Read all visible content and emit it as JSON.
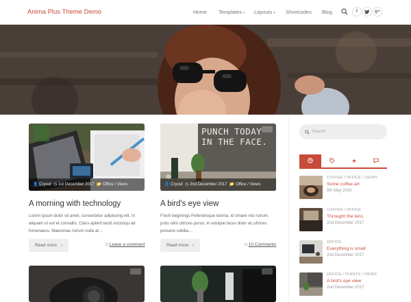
{
  "site": {
    "title": "Anima Plus Theme Demo"
  },
  "nav": [
    {
      "label": "Home",
      "dropdown": false
    },
    {
      "label": "Templates",
      "dropdown": true
    },
    {
      "label": "Layouts",
      "dropdown": true
    },
    {
      "label": "Shortcodes",
      "dropdown": false
    },
    {
      "label": "Blog",
      "dropdown": false
    }
  ],
  "social": {
    "facebook": "f",
    "twitter": "t",
    "googleplus": "g+"
  },
  "posts": [
    {
      "author": "Cryout",
      "date": "1st December 2017",
      "categories": "Office / Views",
      "title": "A morning with technology",
      "excerpt": "Lorem ipsum dolor sit amet, consectetur adipiscing elit. In aliquam ut est et convallis. Class aptent taciti sociosqu ad himenaeos. Maecenas rutrum nulla at…",
      "read_more": "Read more",
      "comments": "Leave a comment",
      "image_icon": "laptop-desk-photo"
    },
    {
      "author": "Cryout",
      "date": "2nd December 2017",
      "categories": "Office / Views",
      "title": "A bird's eye view",
      "excerpt": "Fresh beginings Pellentesque lacinia, in volutpat lacus dolor ac ultrices posuere cubilia…",
      "excerpt_full": "Fresh beginings Pellentesque lacinia, id ornare nisi rutrum, justo odio ultrices purus, in volutpat lacus dolor ac ultrices posuere cubilia…",
      "read_more": "Read more",
      "comments": "10 Comments",
      "image_icon": "punch-today-wall-photo",
      "image_text": "PUNCH TODAY IN THE FACE."
    }
  ],
  "sidebar": {
    "search_placeholder": "Search",
    "tabs": [
      "clock-icon",
      "tag-icon",
      "star-icon",
      "comment-icon"
    ],
    "recent": [
      {
        "categories": "COFFEE / OFFICE / VIEWS",
        "title": "Some coffee art",
        "date": "8th May 2018"
      },
      {
        "categories": "COFFEE / OFFICE",
        "title": "Throught the lens",
        "date": "2nd December 2017"
      },
      {
        "categories": "OFFICE",
        "title": "Everything is small",
        "date": "2nd December 2017"
      },
      {
        "categories": "OFFICE / PLANTS / VIEWS",
        "title": "A bird's eye view",
        "date": "2nd December 2017"
      }
    ]
  },
  "colors": {
    "accent": "#c84a3a",
    "text": "#555555",
    "heading": "#333333"
  }
}
